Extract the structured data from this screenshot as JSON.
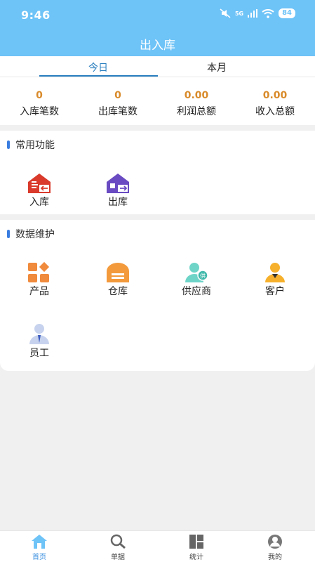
{
  "status_bar": {
    "time": "9:46",
    "battery": "84",
    "network": "5G"
  },
  "header": {
    "title": "出入库"
  },
  "tabs": [
    {
      "label": "今日",
      "active": true
    },
    {
      "label": "本月",
      "active": false
    }
  ],
  "stats": [
    {
      "value": "0",
      "label": "入库笔数"
    },
    {
      "value": "0",
      "label": "出库笔数"
    },
    {
      "value": "0.00",
      "label": "利润总额"
    },
    {
      "value": "0.00",
      "label": "收入总额"
    }
  ],
  "common": {
    "title": "常用功能",
    "items": [
      {
        "label": "入库",
        "icon": "warehouse-in-icon"
      },
      {
        "label": "出库",
        "icon": "warehouse-out-icon"
      }
    ]
  },
  "maintenance": {
    "title": "数据维护",
    "items": [
      {
        "label": "产品",
        "icon": "product-icon"
      },
      {
        "label": "仓库",
        "icon": "warehouse-icon"
      },
      {
        "label": "供应商",
        "icon": "supplier-icon"
      },
      {
        "label": "客户",
        "icon": "customer-icon"
      },
      {
        "label": "员工",
        "icon": "employee-icon"
      }
    ],
    "supplier_badge": "供"
  },
  "nav": [
    {
      "label": "首页",
      "icon": "home-icon",
      "active": true
    },
    {
      "label": "单据",
      "icon": "search-icon",
      "active": false
    },
    {
      "label": "统计",
      "icon": "stats-icon",
      "active": false
    },
    {
      "label": "我的",
      "icon": "profile-icon",
      "active": false
    }
  ],
  "colors": {
    "header": "#6ec3f7",
    "accent": "#2a7fbf",
    "stat_value": "#d98b2b",
    "nav_active": "#3a8fe0"
  }
}
